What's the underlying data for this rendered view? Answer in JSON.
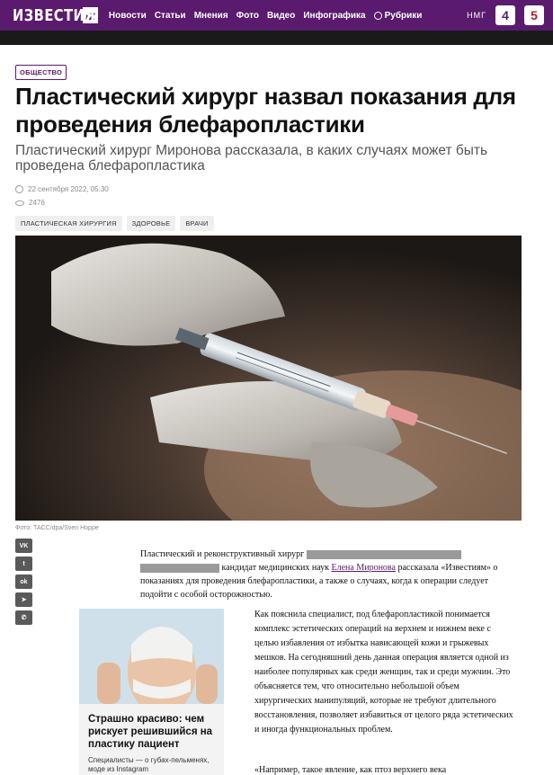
{
  "header": {
    "logo_text": "ИЗВЕСТИЯ",
    "logo_badge": "iz",
    "nav": [
      "Новости",
      "Статьи",
      "Мнения",
      "Фото",
      "Видео",
      "Инфографика"
    ],
    "rubrics_label": "Рубрики",
    "nmg": "НМГ",
    "channel_4": "4",
    "channel_5": "5",
    "brand_color": "#5a1a6d"
  },
  "article": {
    "rubric": "ОБЩЕСТВО",
    "title": "Пластический хирург назвал показания для проведения блефаропластики",
    "subtitle": "Пластический хирург Миронова рассказала, в каких случаях может быть проведена блефаропластика",
    "date": "22 сентября 2022, 05:30",
    "views": "2476",
    "tags": [
      "ПЛАСТИЧЕСКАЯ ХИРУРГИЯ",
      "ЗДОРОВЬЕ",
      "ВРАЧИ"
    ],
    "photo_credit": "Фото: ТАСС/dpa/Sven Hoppe",
    "lead_part1": "Пластический и реконструктивный хирург",
    "lead_part2": "кандидат медицинских наук",
    "lead_link": "Елена Миронова",
    "lead_part3": "рассказала «Известиям» о показаниях для проведения блефаропластики, а также о случаях, когда к операции следует подойти с особой осторожностью.",
    "para1": "Как пояснила специалист, под блефаропластикой понимается комплекс эстетических операций на верхнем и нижнем веке с целью избавления от избытка нависающей кожи и грыжевых мешков. На сегодняшний день данная операция является одной из наиболее популярных как среди женщин, так и среди мужчин. Это объясняется тем, что относительно небольшой объем хирургических манипуляций, которые не требуют длительного восстановления, позволяет избавиться от целого ряда эстетических и иногда функциональных проблем.",
    "para2": "«Например, такое явление, как птоз верхнего века"
  },
  "share": [
    "vk-icon",
    "twitter-icon",
    "odnoklassniki-icon",
    "telegram-icon",
    "viber-icon"
  ],
  "share_labels": [
    "VK",
    "t",
    "ok",
    "➤",
    "✆"
  ],
  "related": {
    "title": "Страшно красиво: чем рискует решившийся на пластику пациент",
    "snippet": "Специалисты — о губах-пельменях, моде из Instagram"
  }
}
